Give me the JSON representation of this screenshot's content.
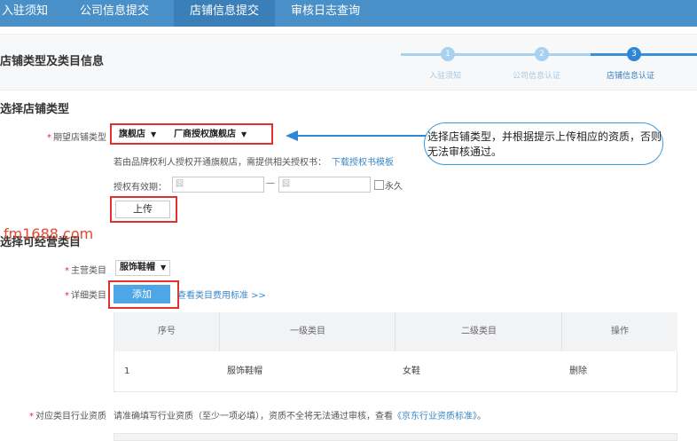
{
  "nav": {
    "tabs": [
      {
        "label": "入驻须知"
      },
      {
        "label": "公司信息提交"
      },
      {
        "label": "店铺信息提交"
      },
      {
        "label": "审核日志查询"
      }
    ]
  },
  "page_title": "店铺类型及类目信息",
  "steps": [
    {
      "num": "1",
      "label": "入驻须知"
    },
    {
      "num": "2",
      "label": "公司信息认证"
    },
    {
      "num": "3",
      "label": "店铺信息认证"
    }
  ],
  "store_type": {
    "section_title": "选择店铺类型",
    "field_label": "期望店铺类型",
    "select_1": "旗舰店",
    "select_2": "厂商授权旗舰店",
    "hint": "若由品牌权利人授权开通旗舰店，需提供相关授权书：",
    "hint_link": "下载授权书模板",
    "validity_label": "授权有效期：",
    "date_placeholder": "囧",
    "date_separator": "—",
    "permanent_label": "永久",
    "upload_button": "上传"
  },
  "callout": {
    "text": "选择店铺类型，并根据提示上传相应的资质，否则无法审核通过。"
  },
  "watermark": "fm1688.com",
  "category": {
    "section_title": "选择可经营类目",
    "main_label": "主营类目",
    "main_value": "服饰鞋帽",
    "detail_label": "详细类目",
    "add_button": "添加",
    "view_link": "查看类目费用标准 >>"
  },
  "table": {
    "headers": [
      "序号",
      "一级类目",
      "二级类目",
      "操作"
    ],
    "rows": [
      {
        "index": "1",
        "level1": "服饰鞋帽",
        "level2": "女鞋",
        "action": "删除"
      }
    ]
  },
  "qualification": {
    "label": "对应类目行业资质",
    "text": "请准确填写行业资质（至少一项必填），资质不全将无法通过审核，查看",
    "link": "《京东行业资质标准》",
    "suffix": "。"
  },
  "colors": {
    "nav_bg": "#4a90c8",
    "accent_blue": "#4ea6e6",
    "highlight_red": "#e0322d",
    "link_blue": "#3a88c8"
  }
}
